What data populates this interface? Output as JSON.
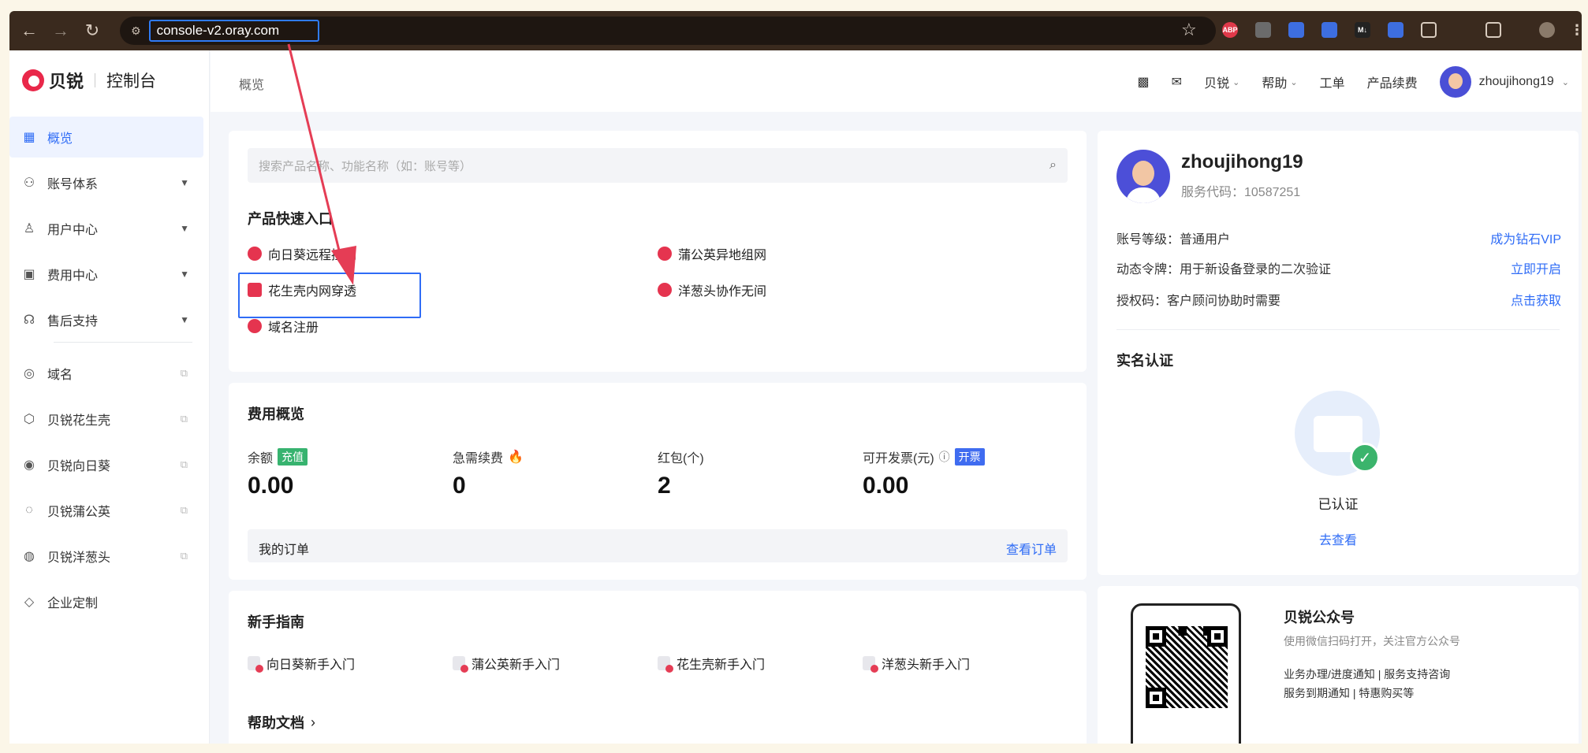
{
  "browser": {
    "url": "console-v2.oray.com",
    "extensions": [
      {
        "name": "abp-icon",
        "label": "ABP",
        "color": "#e0394a"
      },
      {
        "name": "extension-cloud-icon",
        "label": "",
        "color": "#6b6b6b"
      },
      {
        "name": "extension-blue-icon",
        "label": "",
        "color": "#3d6ee0"
      },
      {
        "name": "translate-icon",
        "label": "",
        "color": "#3d6ee0"
      },
      {
        "name": "markdown-icon",
        "label": "M↓",
        "color": "#222222"
      },
      {
        "name": "screenshot-icon",
        "label": "",
        "color": "#3d6ee0"
      },
      {
        "name": "puzzle-icon",
        "label": "",
        "color": "#5a4a3e"
      },
      {
        "name": "reading-list-icon",
        "label": "",
        "color": "#5a4a3e"
      }
    ]
  },
  "logo": {
    "brand": "贝锐",
    "sub": "控制台"
  },
  "sidebar": {
    "items": [
      {
        "label": "概览",
        "icon": "grid-icon"
      },
      {
        "label": "账号体系",
        "icon": "users-icon"
      },
      {
        "label": "用户中心",
        "icon": "user-icon"
      },
      {
        "label": "费用中心",
        "icon": "wallet-icon"
      },
      {
        "label": "售后支持",
        "icon": "headset-icon"
      },
      {
        "label": "域名",
        "icon": "globe-icon"
      },
      {
        "label": "贝锐花生壳",
        "icon": "cube-icon"
      },
      {
        "label": "贝锐向日葵",
        "icon": "sunflower-icon"
      },
      {
        "label": "贝锐蒲公英",
        "icon": "dandelion-icon"
      },
      {
        "label": "贝锐洋葱头",
        "icon": "onion-icon"
      },
      {
        "label": "企业定制",
        "icon": "diamond-icon"
      }
    ]
  },
  "topbar": {
    "breadcrumb": "概览",
    "nav": {
      "beirui": "贝锐",
      "help": "帮助",
      "ticket": "工单",
      "renew": "产品续费"
    },
    "username": "zhoujihong19"
  },
  "search": {
    "placeholder": "搜索产品名称、功能名称（如：账号等）"
  },
  "quick_entry": {
    "title": "产品快速入口",
    "items": [
      {
        "label": "向日葵远程控制",
        "color": "#e5344f"
      },
      {
        "label": "蒲公英异地组网",
        "color": "#e5344f"
      },
      {
        "label": "花生壳内网穿透",
        "color": "#e5344f"
      },
      {
        "label": "洋葱头协作无间",
        "color": "#e5344f"
      },
      {
        "label": "域名注册",
        "color": "#e5344f"
      }
    ]
  },
  "fees": {
    "title": "费用概览",
    "balance_label": "余额",
    "recharge_tag": "充值",
    "balance": "0.00",
    "urgent_label": "急需续费",
    "urgent": "0",
    "redpacket_label": "红包(个)",
    "redpacket": "2",
    "invoice_label": "可开发票(元)",
    "invoice_tag": "开票",
    "invoice": "0.00",
    "orders_label": "我的订单",
    "orders_link": "查看订单"
  },
  "guide": {
    "title": "新手指南",
    "items": [
      "向日葵新手入门",
      "蒲公英新手入门",
      "花生壳新手入门",
      "洋葱头新手入门"
    ],
    "docs": "帮助文档"
  },
  "profile": {
    "name": "zhoujihong19",
    "service_code": "服务代码：10587251",
    "level": "账号等级：普通用户",
    "level_link": "成为钻石VIP",
    "token": "动态令牌：用于新设备登录的二次验证",
    "token_link": "立即开启",
    "auth": "授权码：客户顾问协助时需要",
    "auth_link": "点击获取",
    "cert_title": "实名认证",
    "cert_status": "已认证",
    "cert_link": "去查看"
  },
  "official": {
    "title": "贝锐公众号",
    "desc": "使用微信扫码打开，关注官方公众号",
    "line1": "业务办理/进度通知 | 服务支持咨询",
    "line2": "服务到期通知 | 特惠购买等"
  },
  "colors": {
    "accent": "#2f6cf6",
    "brand": "#e9284a",
    "annotation": "#e53d55"
  }
}
